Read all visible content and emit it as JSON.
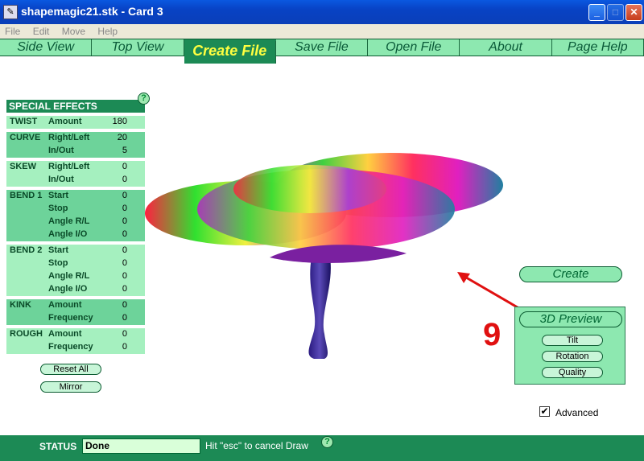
{
  "window": {
    "title": "shapemagic21.stk - Card 3"
  },
  "menu": [
    "File",
    "Edit",
    "Move",
    "Help"
  ],
  "nav": [
    {
      "label": "Side View",
      "active": false
    },
    {
      "label": "Top View",
      "active": false
    },
    {
      "label": "Create File",
      "active": true
    },
    {
      "label": "Save File",
      "active": false
    },
    {
      "label": "Open File",
      "active": false
    },
    {
      "label": "About",
      "active": false
    },
    {
      "label": "Page Help",
      "active": false
    }
  ],
  "effects": {
    "header": "SPECIAL EFFECTS",
    "help": "?",
    "groups": [
      {
        "name": "TWIST",
        "rows": [
          {
            "param": "Amount",
            "value": "180"
          }
        ]
      },
      {
        "name": "CURVE",
        "rows": [
          {
            "param": "Right/Left",
            "value": "20"
          },
          {
            "param": "In/Out",
            "value": "5"
          }
        ]
      },
      {
        "name": "SKEW",
        "rows": [
          {
            "param": "Right/Left",
            "value": "0"
          },
          {
            "param": "In/Out",
            "value": "0"
          }
        ]
      },
      {
        "name": "BEND 1",
        "rows": [
          {
            "param": "Start",
            "value": "0"
          },
          {
            "param": "Stop",
            "value": "0"
          },
          {
            "param": "Angle R/L",
            "value": "0"
          },
          {
            "param": "Angle I/O",
            "value": "0"
          }
        ]
      },
      {
        "name": "BEND 2",
        "rows": [
          {
            "param": "Start",
            "value": "0"
          },
          {
            "param": "Stop",
            "value": "0"
          },
          {
            "param": "Angle R/L",
            "value": "0"
          },
          {
            "param": "Angle I/O",
            "value": "0"
          }
        ]
      },
      {
        "name": "KINK",
        "rows": [
          {
            "param": "Amount",
            "value": "0"
          },
          {
            "param": "Frequency",
            "value": "0"
          }
        ]
      },
      {
        "name": "ROUGH",
        "rows": [
          {
            "param": "Amount",
            "value": "0"
          },
          {
            "param": "Frequency",
            "value": "0"
          }
        ]
      }
    ],
    "reset_label": "Reset All",
    "mirror_label": "Mirror"
  },
  "actions": {
    "create_label": "Create",
    "preview_label": "3D Preview",
    "tilt_label": "Tilt",
    "rotation_label": "Rotation",
    "quality_label": "Quality",
    "advanced_label": "Advanced",
    "advanced_checked": true,
    "annotation_number": "9"
  },
  "status": {
    "label": "STATUS",
    "value": "Done",
    "hint": "Hit \"esc\" to cancel Draw",
    "help": "?"
  },
  "colors": {
    "accent_green": "#1c8a55",
    "tab_green": "#8de8b0",
    "annotation_red": "#e01010"
  }
}
